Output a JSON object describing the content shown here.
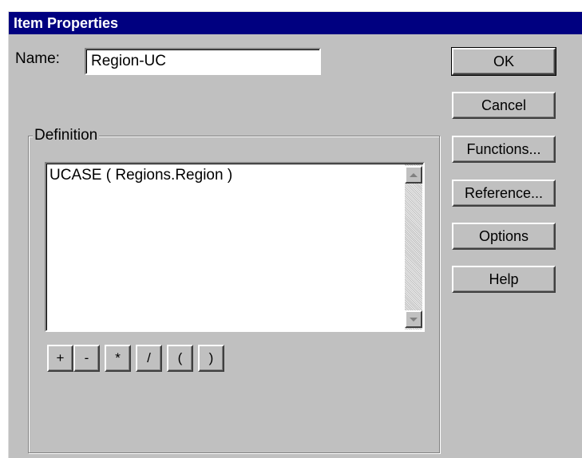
{
  "window": {
    "title": "Item Properties"
  },
  "name_field": {
    "label": "Name:",
    "value": "Region-UC"
  },
  "buttons": {
    "ok": "OK",
    "cancel": "Cancel",
    "functions": "Functions...",
    "reference": "Reference...",
    "options": "Options",
    "help": "Help"
  },
  "definition": {
    "group_label": "Definition",
    "text": "UCASE ( Regions.Region )",
    "operators": [
      "+",
      "-",
      "*",
      "/",
      "(",
      ")"
    ]
  },
  "colors": {
    "titlebar": "#000080",
    "face": "#c0c0c0"
  }
}
